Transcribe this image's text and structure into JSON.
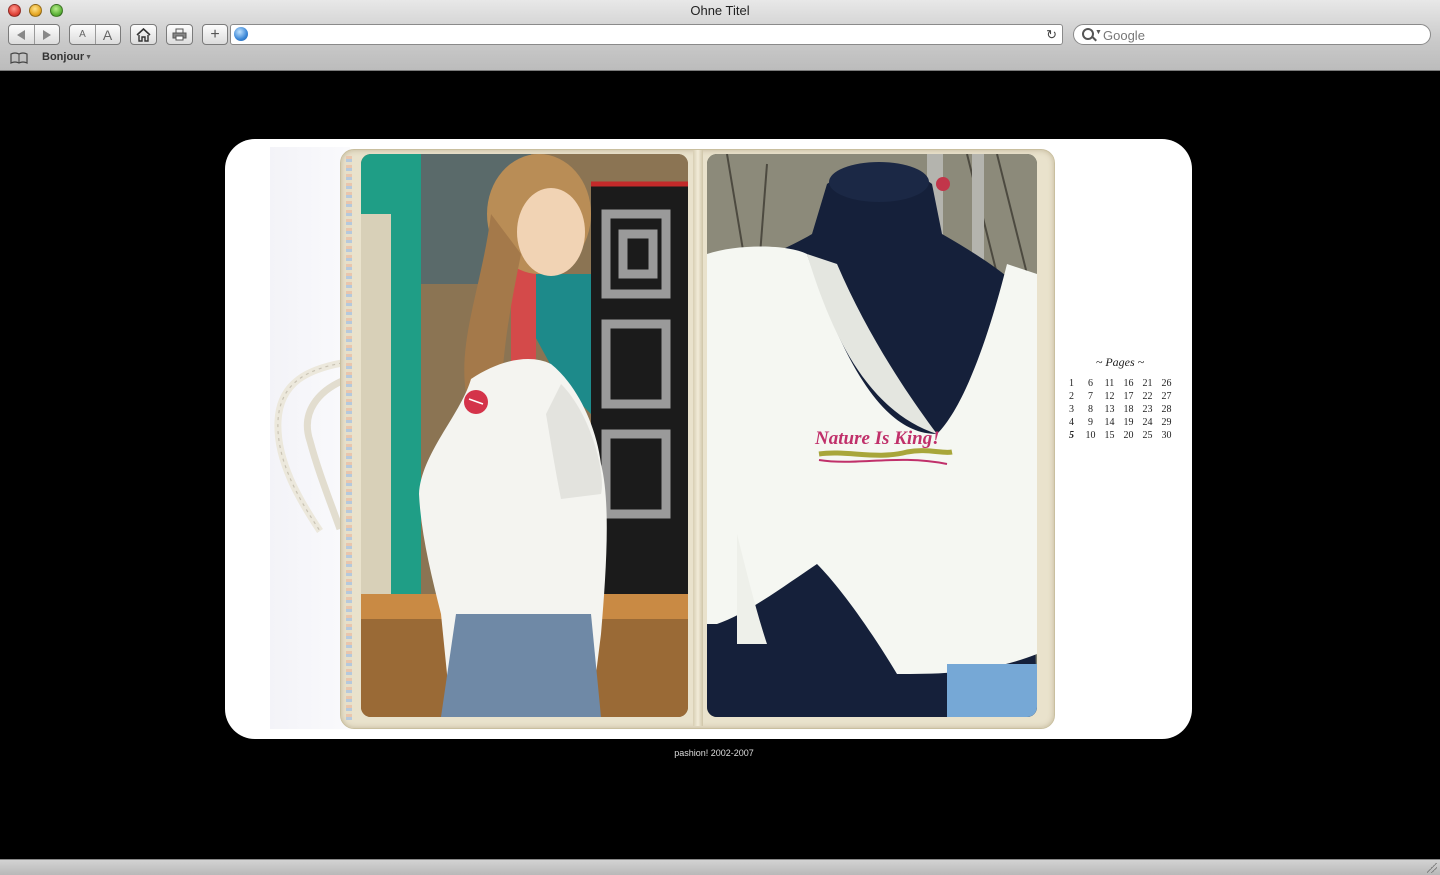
{
  "window": {
    "title": "Ohne Titel"
  },
  "toolbar": {
    "smaller_text_label": "A",
    "larger_text_label": "A",
    "add_label": "+",
    "url_value": "",
    "search_placeholder": "Google"
  },
  "bookmarks_bar": {
    "items": [
      {
        "label": "Bonjour"
      }
    ]
  },
  "page": {
    "poster_text": "Nature Is King!",
    "pages_heading": "~ Pages ~",
    "pages_grid": [
      [
        "1",
        "6",
        "11",
        "16",
        "21",
        "26"
      ],
      [
        "2",
        "7",
        "12",
        "17",
        "22",
        "27"
      ],
      [
        "3",
        "8",
        "13",
        "18",
        "23",
        "28"
      ],
      [
        "4",
        "9",
        "14",
        "19",
        "24",
        "29"
      ],
      [
        "5",
        "10",
        "15",
        "20",
        "25",
        "30"
      ]
    ],
    "current_page": "5",
    "footer": "pashion! 2002-2007"
  },
  "colors": {
    "page_background": "#000000",
    "card_background": "#ffffff",
    "print_text": "#c0306a"
  }
}
